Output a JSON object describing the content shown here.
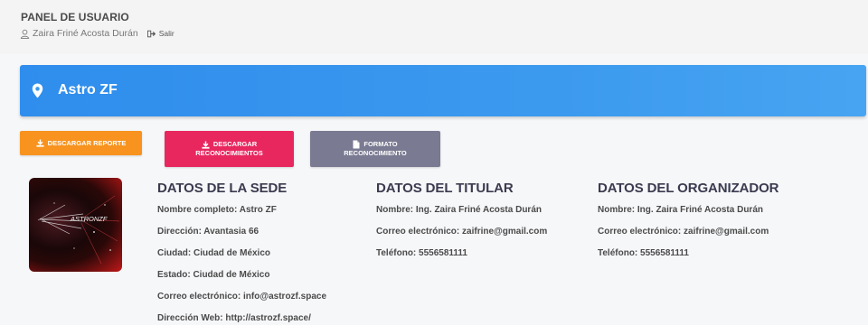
{
  "panel": {
    "title": "PANEL DE USUARIO",
    "user_name": "Zaira Friné Acosta Durán",
    "logout_label": "Salir"
  },
  "venue": {
    "name": "Astro ZF",
    "header_color": "#3b99ee"
  },
  "buttons": {
    "download_report": "DESCARGAR REPORTE",
    "download_recognitions_line1": "DESCARGAR",
    "download_recognitions_line2": "RECONOCIMIENTOS",
    "format_line1": "FORMATO",
    "format_line2": "RECONOCIMIENTO"
  },
  "logo": {
    "text": "ASTRONZF"
  },
  "sede": {
    "heading": "DATOS DE LA SEDE",
    "full_name": "Nombre completo: Astro ZF",
    "address": "Dirección: Avantasia 66",
    "city": "Ciudad: Ciudad de México",
    "state": "Estado: Ciudad de México",
    "email": "Correo electrónico: info@astrozf.space",
    "web": "Dirección Web: http://astrozf.space/"
  },
  "titular": {
    "heading": "DATOS DEL TITULAR",
    "name": "Nombre: Ing. Zaira Friné Acosta Durán",
    "email": "Correo electrónico: zaifrine@gmail.com",
    "phone": "Teléfono: 5556581111"
  },
  "organizador": {
    "heading": "DATOS DEL ORGANIZADOR",
    "name": "Nombre: Ing. Zaira Friné Acosta Durán",
    "email": "Correo electrónico: zaifrine@gmail.com",
    "phone": "Teléfono: 5556581111"
  },
  "colors": {
    "orange": "#f7931e",
    "pink": "#e8275f",
    "grey": "#7a7a92"
  }
}
